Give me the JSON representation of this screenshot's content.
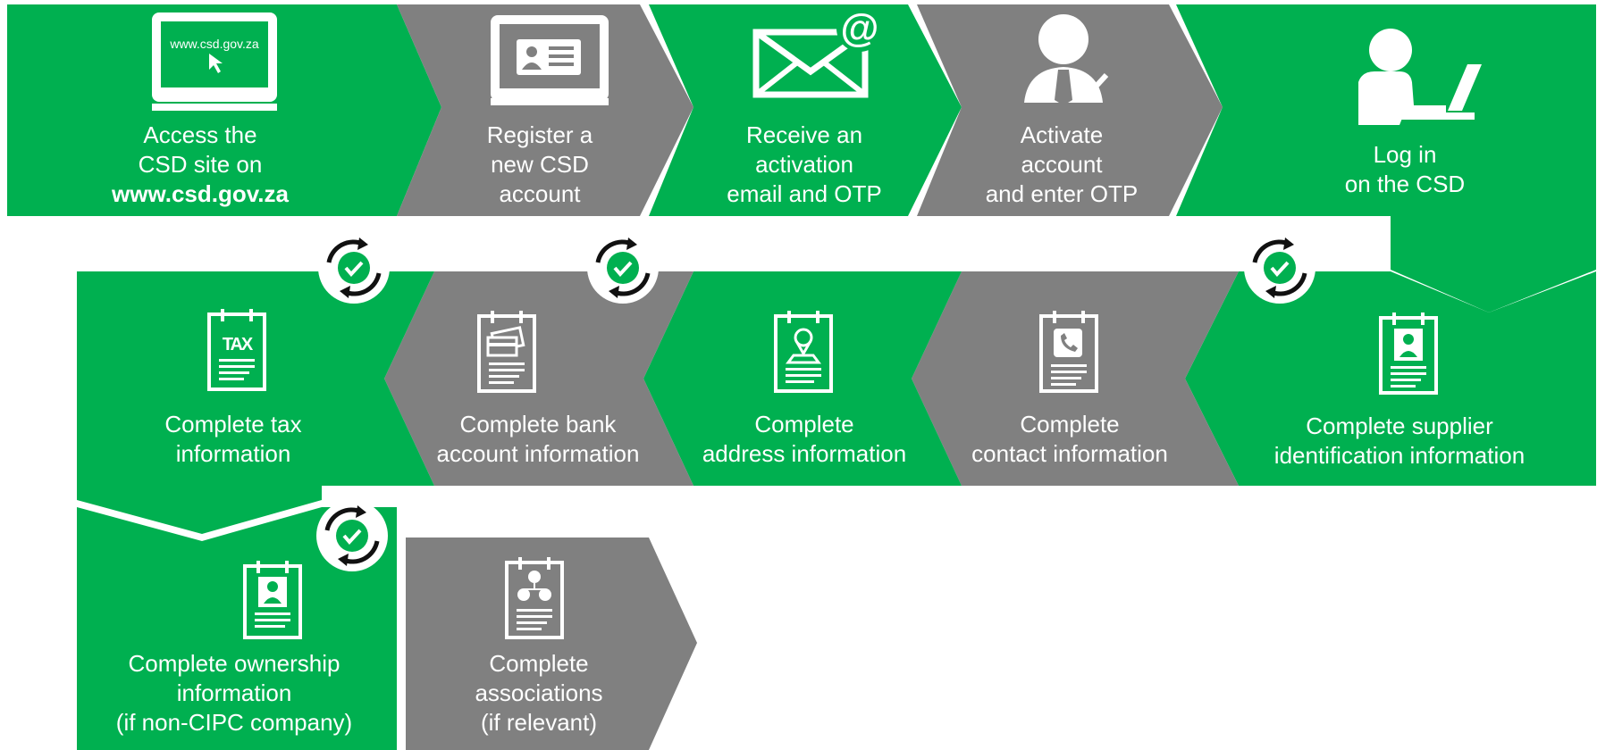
{
  "colors": {
    "green": "#00b050",
    "gray": "#808080",
    "white": "#ffffff",
    "dark": "#111111"
  },
  "steps": [
    {
      "id": "access",
      "color": "green",
      "icon": "monitor-with-url-icon",
      "icon_text": "www.csd.gov.za",
      "lines": [
        "Access the",
        "CSD site on",
        "www.csd.gov.za"
      ],
      "bold_last": true
    },
    {
      "id": "register",
      "color": "gray",
      "icon": "monitor-with-id-card-icon",
      "lines": [
        "Register a",
        "new CSD",
        "account"
      ]
    },
    {
      "id": "email",
      "color": "green",
      "icon": "email-at-icon",
      "lines": [
        "Receive an",
        "activation",
        "email and OTP"
      ]
    },
    {
      "id": "activate",
      "color": "gray",
      "icon": "user-tick-icon",
      "lines": [
        "Activate",
        "account",
        "and enter OTP"
      ]
    },
    {
      "id": "login",
      "color": "green",
      "icon": "user-laptop-icon",
      "lines": [
        "Log in",
        "on the CSD"
      ]
    },
    {
      "id": "supplier",
      "color": "green",
      "icon": "clipboard-person-icon",
      "lines": [
        "Complete supplier",
        "identification information"
      ]
    },
    {
      "id": "contact",
      "color": "gray",
      "icon": "clipboard-phone-icon",
      "lines": [
        "Complete",
        "contact information"
      ]
    },
    {
      "id": "address",
      "color": "green",
      "icon": "clipboard-location-icon",
      "lines": [
        "Complete",
        "address information"
      ]
    },
    {
      "id": "bank",
      "color": "gray",
      "icon": "clipboard-cards-icon",
      "lines": [
        "Complete bank",
        "account information"
      ]
    },
    {
      "id": "tax",
      "color": "green",
      "icon": "clipboard-tax-icon",
      "icon_text": "TAX",
      "lines": [
        "Complete tax",
        "information"
      ]
    },
    {
      "id": "ownership",
      "color": "green",
      "icon": "clipboard-person-icon",
      "lines": [
        "Complete ownership",
        "information",
        "(if non-CIPC company)"
      ]
    },
    {
      "id": "associations",
      "color": "gray",
      "icon": "clipboard-network-icon",
      "lines": [
        "Complete",
        "associations",
        "(if relevant)"
      ]
    }
  ],
  "checkpoints": [
    "refresh-check-icon",
    "refresh-check-icon",
    "refresh-check-icon",
    "refresh-check-icon"
  ]
}
